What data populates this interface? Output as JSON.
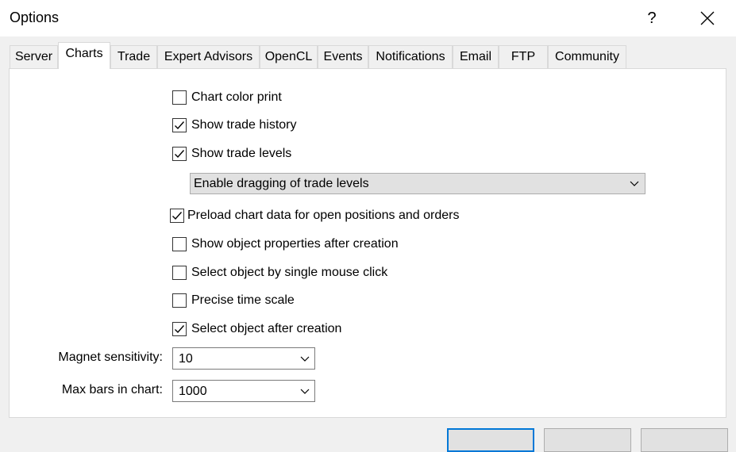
{
  "window": {
    "title": "Options",
    "help_label": "?"
  },
  "tabs": [
    {
      "label": "Server"
    },
    {
      "label": "Charts"
    },
    {
      "label": "Trade"
    },
    {
      "label": "Expert Advisors"
    },
    {
      "label": "OpenCL"
    },
    {
      "label": "Events"
    },
    {
      "label": "Notifications"
    },
    {
      "label": "Email"
    },
    {
      "label": "FTP"
    },
    {
      "label": "Community"
    }
  ],
  "active_tab": "Charts",
  "options": [
    {
      "label": "Chart color print",
      "checked": false
    },
    {
      "label": "Show trade history",
      "checked": true
    },
    {
      "label": "Show trade levels",
      "checked": true
    },
    {
      "label": "Preload chart data for open positions and orders",
      "checked": true
    },
    {
      "label": "Show object properties after creation",
      "checked": false
    },
    {
      "label": "Select object by single mouse click",
      "checked": false
    },
    {
      "label": "Precise time scale",
      "checked": false
    },
    {
      "label": "Select object after creation",
      "checked": true
    }
  ],
  "trade_levels_dropdown": {
    "value": "Enable dragging of trade levels"
  },
  "magnet": {
    "label": "Magnet sensitivity:",
    "value": "10"
  },
  "max_bars": {
    "label": "Max bars in chart:",
    "value": "1000"
  }
}
